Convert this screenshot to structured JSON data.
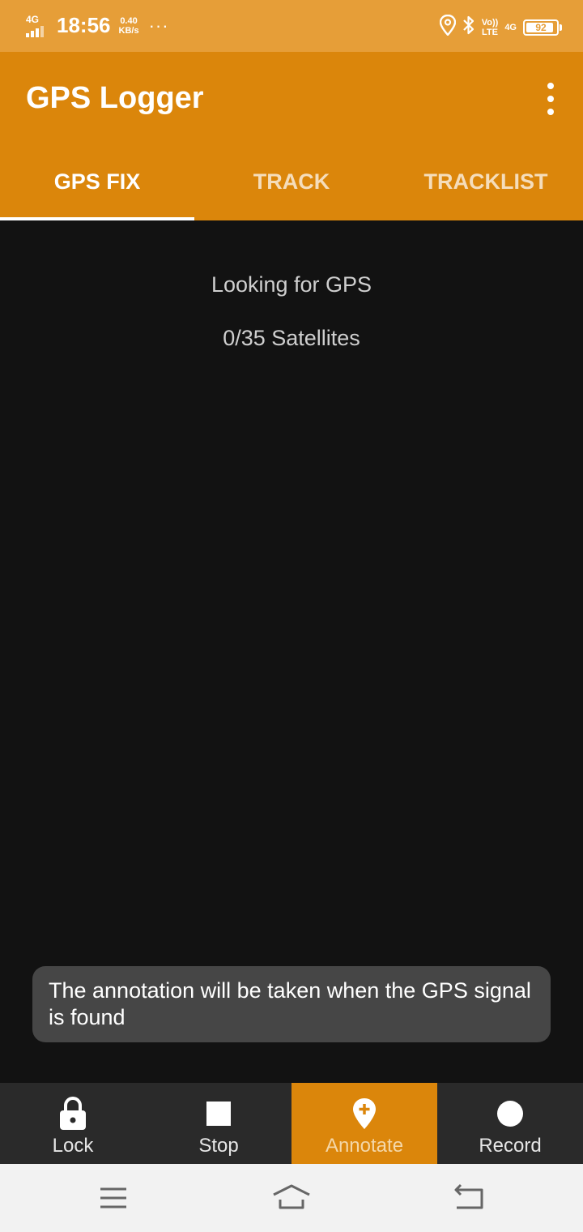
{
  "status_bar": {
    "network_type": "4G",
    "time": "18:56",
    "speed_value": "0.40",
    "speed_unit": "KB/s",
    "more_dots": "···",
    "volte_top": "Vo))",
    "volte_bottom": "LTE",
    "network_type_right": "4G",
    "battery_level": "92",
    "icons": [
      "location-icon",
      "bluetooth-icon",
      "battery-icon"
    ]
  },
  "app_bar": {
    "title": "GPS Logger",
    "overflow_icon": "more-vertical-icon"
  },
  "tabs": [
    {
      "label": "GPS FIX",
      "active": true
    },
    {
      "label": "TRACK",
      "active": false
    },
    {
      "label": "TRACKLIST",
      "active": false
    }
  ],
  "main": {
    "status": "Looking for GPS",
    "satellites": "0/35 Satellites"
  },
  "toast": {
    "message": "The annotation will be taken when the GPS signal is found"
  },
  "bottom_bar": [
    {
      "label": "Lock",
      "icon": "lock-icon",
      "active": false
    },
    {
      "label": "Stop",
      "icon": "stop-icon",
      "active": false
    },
    {
      "label": "Annotate",
      "icon": "add-location-icon",
      "active": true
    },
    {
      "label": "Record",
      "icon": "record-icon",
      "active": false
    }
  ],
  "nav_bar": {
    "icons": [
      "menu-icon",
      "home-icon",
      "back-icon"
    ]
  },
  "colors": {
    "status_bar": "#E69E38",
    "app_bar": "#DB860B",
    "background": "#121212",
    "toast": "#464646",
    "bottom_bar": "#2A2A2A",
    "nav_bar": "#F2F2F2"
  }
}
